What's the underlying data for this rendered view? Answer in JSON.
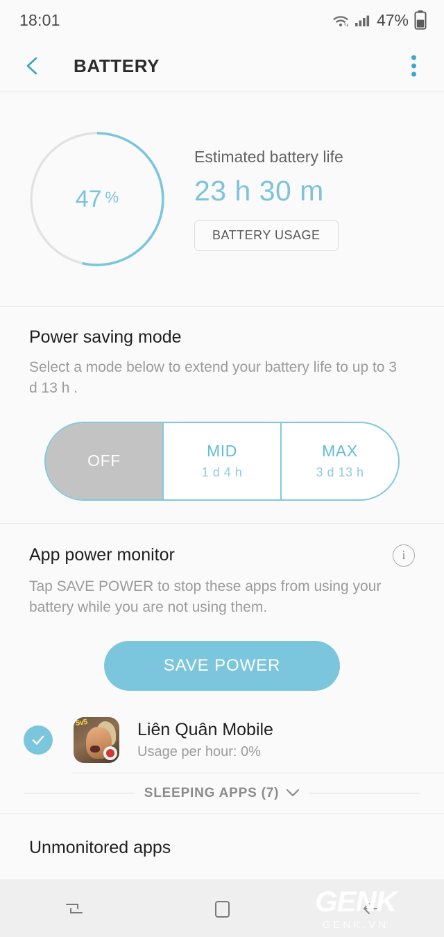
{
  "status_bar": {
    "time": "18:01",
    "battery_percent": "47%",
    "wifi_icon": "wifi-icon",
    "signal_icon": "signal-bars-icon",
    "battery_icon": "battery-icon"
  },
  "app_bar": {
    "back_icon": "back-chevron-icon",
    "title": "BATTERY",
    "overflow_icon": "more-options-icon"
  },
  "battery_summary": {
    "gauge_value": "47",
    "gauge_symbol": "%",
    "gauge_percent": 47,
    "estimated_label": "Estimated battery life",
    "estimated_value": "23 h 30 m",
    "usage_button": "BATTERY USAGE"
  },
  "power_saving": {
    "title": "Power saving mode",
    "description": "Select a mode below to extend your battery life to up to 3 d 13 h .",
    "modes": [
      {
        "name": "OFF",
        "sub": "",
        "selected": true
      },
      {
        "name": "MID",
        "sub": "1 d 4 h",
        "selected": false
      },
      {
        "name": "MAX",
        "sub": "3 d 13 h",
        "selected": false
      }
    ]
  },
  "app_power_monitor": {
    "title": "App power monitor",
    "info_icon": "info-icon",
    "description": "Tap SAVE POWER to stop these apps from using your battery while you are not using them.",
    "save_power_button": "SAVE POWER",
    "apps": [
      {
        "checked": true,
        "check_icon": "check-circle-icon",
        "icon": "lien-quan-mobile-app-icon",
        "icon_badge": "5v5",
        "name": "Liên Quân Mobile",
        "usage": "Usage per hour: 0%"
      }
    ],
    "sleeping_apps_label": "SLEEPING APPS (7)",
    "sleeping_apps_chevron": "chevron-down-icon"
  },
  "unmonitored": {
    "title": "Unmonitored apps"
  },
  "nav_bar": {
    "recents_icon": "recents-icon",
    "home_icon": "home-icon",
    "back_icon": "back-arrow-icon"
  },
  "watermark": {
    "main": "GENK",
    "sub": "GENK.VN"
  },
  "colors": {
    "accent": "#7cc6dd",
    "accent_dark": "#3fa8c8",
    "background": "#fafafa",
    "nav_background": "#efefef",
    "text_primary": "#1f1f1f",
    "text_secondary": "#9b9b9b",
    "selected_segment": "#c3c3c3"
  }
}
